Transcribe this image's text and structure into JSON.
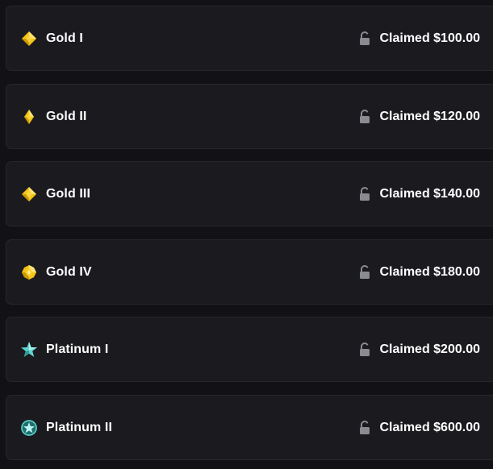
{
  "tiers": [
    {
      "name": "Gold I",
      "status": "Claimed $100.00",
      "icon": "gold-gem-1-icon"
    },
    {
      "name": "Gold II",
      "status": "Claimed $120.00",
      "icon": "gold-gem-2-icon"
    },
    {
      "name": "Gold III",
      "status": "Claimed $140.00",
      "icon": "gold-gem-3-icon"
    },
    {
      "name": "Gold IV",
      "status": "Claimed $180.00",
      "icon": "gold-gem-4-icon"
    },
    {
      "name": "Platinum I",
      "status": "Claimed $200.00",
      "icon": "platinum-star-icon"
    },
    {
      "name": "Platinum II",
      "status": "Claimed $600.00",
      "icon": "platinum-star-badge-icon"
    }
  ],
  "colors": {
    "background": "#121216",
    "card": "#1a1a1f",
    "card_border": "#26272c",
    "text": "#ffffff",
    "lock": "#8a8b90",
    "gold": "#f5c518",
    "platinum": "#5fd3cf"
  }
}
